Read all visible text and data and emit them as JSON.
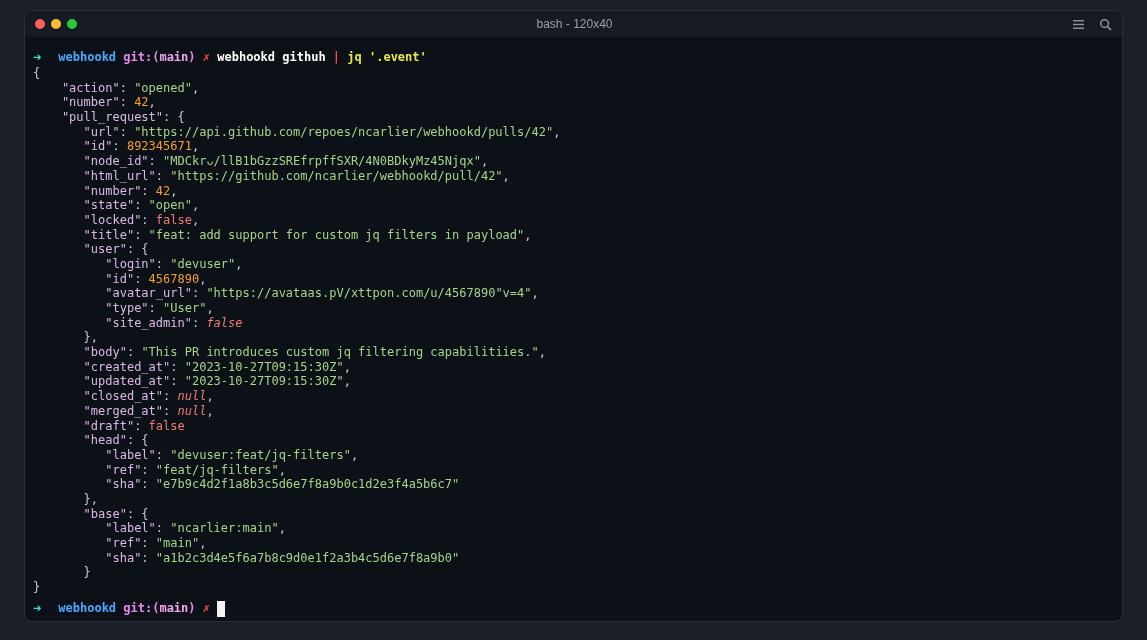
{
  "window": {
    "title": "bash - 120x40"
  },
  "prompts": [
    {
      "tokens": [
        {
          "kind": "arrow",
          "text": "➜"
        },
        {
          "kind": "dir",
          "text": "webhookd"
        },
        {
          "kind": "git",
          "text": "git:("
        },
        {
          "kind": "branch",
          "text": "main"
        },
        {
          "kind": "git",
          "text": ")"
        },
        {
          "kind": "dirty",
          "text": "✗"
        },
        {
          "kind": "cmd",
          "text": "webhookd githuh"
        },
        {
          "kind": "pipe",
          "text": "|"
        },
        {
          "kind": "jq",
          "text": "jq '.event'"
        }
      ]
    },
    {
      "tokens": [
        {
          "kind": "arrow",
          "text": "➜"
        },
        {
          "kind": "dir",
          "text": "webhookd"
        },
        {
          "kind": "git",
          "text": "git:("
        },
        {
          "kind": "branch",
          "text": "main"
        },
        {
          "kind": "git",
          "text": ")"
        },
        {
          "kind": "dirty",
          "text": "✗"
        }
      ],
      "cursor": true
    }
  ],
  "output": [
    {
      "tokens": [
        {
          "kind": "punct",
          "text": "{"
        }
      ],
      "children": [
        {
          "tokens": [
            {
              "kind": "key",
              "text": "\"action\""
            },
            {
              "kind": "punct",
              "text": ": "
            },
            {
              "kind": "string",
              "text": "\"opened\""
            },
            {
              "kind": "punct",
              "text": ","
            }
          ]
        },
        {
          "tokens": [
            {
              "kind": "key",
              "text": "\"number\""
            },
            {
              "kind": "punct",
              "text": ": "
            },
            {
              "kind": "number",
              "text": "42"
            },
            {
              "kind": "punct",
              "text": ","
            }
          ]
        },
        {
          "tokens": [
            {
              "kind": "key",
              "text": "\"pull_request\""
            },
            {
              "kind": "punct",
              "text": ": {"
            }
          ],
          "children": [
            {
              "tokens": [
                {
                  "kind": "key",
                  "text": "\"url\""
                },
                {
                  "kind": "punct",
                  "text": ": "
                },
                {
                  "kind": "string",
                  "text": "\"https://api.github.com/repoes/ncarlier/webhookd/pulls/42\""
                },
                {
                  "kind": "punct",
                  "text": ","
                }
              ]
            },
            {
              "tokens": [
                {
                  "kind": "key",
                  "text": "\"id\""
                },
                {
                  "kind": "punct",
                  "text": ": "
                },
                {
                  "kind": "number",
                  "text": "892345671"
                },
                {
                  "kind": "punct",
                  "text": ","
                }
              ]
            },
            {
              "tokens": [
                {
                  "kind": "key",
                  "text": "\"node_id\""
                },
                {
                  "kind": "punct",
                  "text": ": "
                },
                {
                  "kind": "string",
                  "text": "\"MDCkrᴗ/llB1bGzzSREfrpffSXR/4N0BDkyMz45Njqx\""
                },
                {
                  "kind": "punct",
                  "text": ","
                }
              ]
            },
            {
              "tokens": [
                {
                  "kind": "key",
                  "text": "\"html_url\""
                },
                {
                  "kind": "punct",
                  "text": ": "
                },
                {
                  "kind": "string",
                  "text": "\"https://github.com/ncarlier/webhookd/pull/42\""
                },
                {
                  "kind": "punct",
                  "text": ","
                }
              ]
            },
            {
              "tokens": [
                {
                  "kind": "key",
                  "text": "\"number\""
                },
                {
                  "kind": "punct",
                  "text": ": "
                },
                {
                  "kind": "number",
                  "text": "42"
                },
                {
                  "kind": "punct",
                  "text": ","
                }
              ]
            },
            {
              "tokens": [
                {
                  "kind": "key",
                  "text": "\"state\""
                },
                {
                  "kind": "punct",
                  "text": ": "
                },
                {
                  "kind": "string",
                  "text": "\"open\""
                },
                {
                  "kind": "punct",
                  "text": ","
                }
              ]
            },
            {
              "tokens": [
                {
                  "kind": "key",
                  "text": "\"locked\""
                },
                {
                  "kind": "punct",
                  "text": ": "
                },
                {
                  "kind": "bool",
                  "text": "false"
                },
                {
                  "kind": "punct",
                  "text": ","
                }
              ]
            },
            {
              "tokens": [
                {
                  "kind": "key",
                  "text": "\"title\""
                },
                {
                  "kind": "punct",
                  "text": ": "
                },
                {
                  "kind": "string",
                  "text": "\"feat: add support for custom jq filters in payload\""
                },
                {
                  "kind": "punct",
                  "text": ","
                }
              ]
            },
            {
              "tokens": [
                {
                  "kind": "key",
                  "text": "\"user\""
                },
                {
                  "kind": "punct",
                  "text": ": {"
                }
              ],
              "children": [
                {
                  "tokens": [
                    {
                      "kind": "key",
                      "text": "\"login\""
                    },
                    {
                      "kind": "punct",
                      "text": ": "
                    },
                    {
                      "kind": "string",
                      "text": "\"devuser\""
                    },
                    {
                      "kind": "punct",
                      "text": ","
                    }
                  ]
                },
                {
                  "tokens": [
                    {
                      "kind": "key",
                      "text": "\"id\""
                    },
                    {
                      "kind": "punct",
                      "text": ": "
                    },
                    {
                      "kind": "number",
                      "text": "4567890"
                    },
                    {
                      "kind": "punct",
                      "text": ","
                    }
                  ]
                },
                {
                  "tokens": [
                    {
                      "kind": "key",
                      "text": "\"avatar_url\""
                    },
                    {
                      "kind": "punct",
                      "text": ": "
                    },
                    {
                      "kind": "string",
                      "text": "\"https://avataas.pV/xttpon.com/u/4567890\"v=4\""
                    },
                    {
                      "kind": "punct",
                      "text": ","
                    }
                  ]
                },
                {
                  "tokens": [
                    {
                      "kind": "key",
                      "text": "\"type\""
                    },
                    {
                      "kind": "punct",
                      "text": ": "
                    },
                    {
                      "kind": "string",
                      "text": "\"User\""
                    },
                    {
                      "kind": "punct",
                      "text": ","
                    }
                  ]
                },
                {
                  "tokens": [
                    {
                      "kind": "key",
                      "text": "\"site_admin\""
                    },
                    {
                      "kind": "punct",
                      "text": ": "
                    },
                    {
                      "kind": "null",
                      "text": "false"
                    }
                  ]
                }
              ]
            },
            {
              "tokens": [
                {
                  "kind": "punct",
                  "text": "},"
                }
              ]
            },
            {
              "tokens": [
                {
                  "kind": "key",
                  "text": "\"body\""
                },
                {
                  "kind": "punct",
                  "text": ": "
                },
                {
                  "kind": "string",
                  "text": "\"This PR introduces custom jq filtering capabilitiies.\""
                },
                {
                  "kind": "punct",
                  "text": ","
                }
              ]
            },
            {
              "tokens": [
                {
                  "kind": "key",
                  "text": "\"created_at\""
                },
                {
                  "kind": "punct",
                  "text": ": "
                },
                {
                  "kind": "string",
                  "text": "\"2023-10-27T09:15:30Z\""
                },
                {
                  "kind": "punct",
                  "text": ","
                }
              ]
            },
            {
              "tokens": [
                {
                  "kind": "key",
                  "text": "\"updated_at\""
                },
                {
                  "kind": "punct",
                  "text": ": "
                },
                {
                  "kind": "string",
                  "text": "\"2023-10-27T09:15:30Z\""
                },
                {
                  "kind": "punct",
                  "text": ","
                }
              ]
            },
            {
              "tokens": [
                {
                  "kind": "key",
                  "text": "\"closed_at\""
                },
                {
                  "kind": "punct",
                  "text": ": "
                },
                {
                  "kind": "null",
                  "text": "null"
                },
                {
                  "kind": "punct",
                  "text": ","
                }
              ]
            },
            {
              "tokens": [
                {
                  "kind": "key",
                  "text": "\"merged_at\""
                },
                {
                  "kind": "punct",
                  "text": ": "
                },
                {
                  "kind": "null",
                  "text": "null"
                },
                {
                  "kind": "punct",
                  "text": ","
                }
              ]
            },
            {
              "tokens": [
                {
                  "kind": "key",
                  "text": "\"draft\""
                },
                {
                  "kind": "punct",
                  "text": ": "
                },
                {
                  "kind": "bool",
                  "text": "false"
                }
              ]
            },
            {
              "tokens": [
                {
                  "kind": "key",
                  "text": "\"head\""
                },
                {
                  "kind": "punct",
                  "text": ": {"
                }
              ],
              "children": [
                {
                  "tokens": [
                    {
                      "kind": "key",
                      "text": "\"label\""
                    },
                    {
                      "kind": "punct",
                      "text": ": "
                    },
                    {
                      "kind": "string",
                      "text": "\"devuser:feat/jq-filters\""
                    },
                    {
                      "kind": "punct",
                      "text": ","
                    }
                  ]
                },
                {
                  "tokens": [
                    {
                      "kind": "key",
                      "text": "\"ref\""
                    },
                    {
                      "kind": "punct",
                      "text": ": "
                    },
                    {
                      "kind": "string",
                      "text": "\"feat/jq-filters\""
                    },
                    {
                      "kind": "punct",
                      "text": ","
                    }
                  ]
                },
                {
                  "tokens": [
                    {
                      "kind": "key",
                      "text": "\"sha\""
                    },
                    {
                      "kind": "punct",
                      "text": ": "
                    },
                    {
                      "kind": "string",
                      "text": "\"e7b9c4d2f1a8b3c5d6e7f8a9b0c1d2e3f4a5b6c7\""
                    }
                  ]
                }
              ]
            },
            {
              "tokens": [
                {
                  "kind": "punct",
                  "text": "},"
                }
              ]
            },
            {
              "tokens": [
                {
                  "kind": "key",
                  "text": "\"base\""
                },
                {
                  "kind": "punct",
                  "text": ": {"
                }
              ],
              "children": [
                {
                  "tokens": [
                    {
                      "kind": "key",
                      "text": "\"label\""
                    },
                    {
                      "kind": "punct",
                      "text": ": "
                    },
                    {
                      "kind": "string",
                      "text": "\"ncarlier:main\""
                    },
                    {
                      "kind": "punct",
                      "text": ","
                    }
                  ]
                },
                {
                  "tokens": [
                    {
                      "kind": "key",
                      "text": "\"ref\""
                    },
                    {
                      "kind": "punct",
                      "text": ": "
                    },
                    {
                      "kind": "string",
                      "text": "\"main\""
                    },
                    {
                      "kind": "punct",
                      "text": ","
                    }
                  ]
                },
                {
                  "tokens": [
                    {
                      "kind": "key",
                      "text": "\"sha\""
                    },
                    {
                      "kind": "punct",
                      "text": ": "
                    },
                    {
                      "kind": "string",
                      "text": "\"a1b2c3d4e5f6a7b8c9d0e1f2a3b4c5d6e7f8a9b0\""
                    }
                  ]
                }
              ]
            },
            {
              "tokens": [
                {
                  "kind": "punct",
                  "text": "}"
                }
              ]
            }
          ]
        }
      ]
    },
    {
      "tokens": [
        {
          "kind": "punct",
          "text": "}"
        }
      ]
    }
  ]
}
